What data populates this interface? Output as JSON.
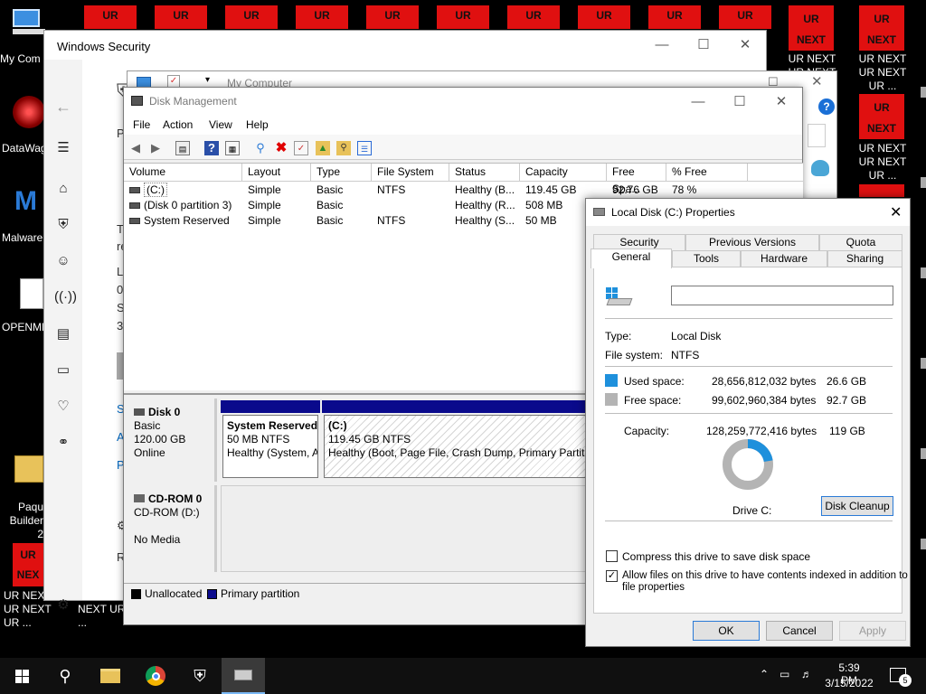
{
  "desktop": {
    "tiles": [
      {
        "text": "UR"
      },
      {
        "text": "UR"
      },
      {
        "text": "UR"
      },
      {
        "text": "UR"
      },
      {
        "text": "UR"
      },
      {
        "text": "UR"
      },
      {
        "text": "UR"
      },
      {
        "text": "UR"
      },
      {
        "text": "UR"
      },
      {
        "text": "UR"
      }
    ],
    "next_tiles": [
      {
        "top": "UR",
        "bottom": "NEXT"
      },
      {
        "top": "UR",
        "bottom": "NEXT"
      },
      {
        "top": "UR",
        "bottom": "NEXT"
      }
    ],
    "icons": [
      {
        "label": "My Com"
      },
      {
        "label": "DataWag"
      },
      {
        "label": "Malware"
      },
      {
        "label": "OPENME"
      },
      {
        "label": "Paqu Builder 2"
      }
    ],
    "right_labels": [
      "UR NEXT UR NEXT UR ...",
      "UR NEXT UR NEXT UR ...",
      "UR NEXT UR NEXT UR ..."
    ],
    "bottom_tile": {
      "top": "UR",
      "bottom": "NEX"
    },
    "bottom_labels": [
      "UR NEXT UR NEXT UR ...",
      "NEXT UR ..."
    ]
  },
  "windows_security": {
    "title": "Windows Security",
    "fragments": [
      "P",
      "T",
      "re",
      "L",
      "0",
      "S",
      "3",
      "S",
      "A",
      "P",
      "R"
    ]
  },
  "my_computer": {
    "title": "My Computer"
  },
  "disk_management": {
    "title": "Disk Management",
    "menu": [
      "File",
      "Action",
      "View",
      "Help"
    ],
    "columns": [
      "Volume",
      "Layout",
      "Type",
      "File System",
      "Status",
      "Capacity",
      "Free Spa...",
      "% Free"
    ],
    "rows": [
      [
        "(C:)",
        "Simple",
        "Basic",
        "NTFS",
        "Healthy (B...",
        "119.45 GB",
        "92.76 GB",
        "78 %"
      ],
      [
        "(Disk 0 partition 3)",
        "Simple",
        "Basic",
        "",
        "Healthy (R...",
        "508 MB",
        "",
        ""
      ],
      [
        "System Reserved",
        "Simple",
        "Basic",
        "NTFS",
        "Healthy (S...",
        "50 MB",
        "",
        ""
      ]
    ],
    "disk0": {
      "name": "Disk 0",
      "type": "Basic",
      "size": "120.00 GB",
      "state": "Online",
      "partitions": [
        {
          "name": "System Reserved",
          "size": "50 MB NTFS",
          "status": "Healthy (System, A"
        },
        {
          "name": "(C:)",
          "size": "119.45 GB NTFS",
          "status": "Healthy (Boot, Page File, Crash Dump, Primary Partitio"
        }
      ]
    },
    "cdrom0": {
      "name": "CD-ROM 0",
      "type": "CD-ROM (D:)",
      "state": "No Media"
    },
    "legend": [
      {
        "label": "Unallocated",
        "color": "#000000"
      },
      {
        "label": "Primary partition",
        "color": "#0a0a8c"
      }
    ]
  },
  "properties": {
    "title": "Local Disk (C:) Properties",
    "tabs_row1": [
      "Security",
      "Previous Versions",
      "Quota"
    ],
    "tabs_row2": [
      "General",
      "Tools",
      "Hardware",
      "Sharing"
    ],
    "name_value": "",
    "type_label": "Type:",
    "type_value": "Local Disk",
    "fs_label": "File system:",
    "fs_value": "NTFS",
    "used_label": "Used space:",
    "used_bytes": "28,656,812,032 bytes",
    "used_gb": "26.6 GB",
    "used_color": "#1e90dc",
    "free_label": "Free space:",
    "free_bytes": "99,602,960,384 bytes",
    "free_gb": "92.7 GB",
    "free_color": "#b4b4b4",
    "capacity_label": "Capacity:",
    "capacity_bytes": "128,259,772,416 bytes",
    "capacity_gb": "119 GB",
    "used_fraction": 0.223,
    "drive_label": "Drive C:",
    "cleanup": "Disk Cleanup",
    "compress": "Compress this drive to save disk space",
    "compress_checked": false,
    "index_line1": "Allow files on this drive to have contents indexed in addition to",
    "index_line2": "file properties",
    "index_checked": true,
    "ok": "OK",
    "cancel": "Cancel",
    "apply": "Apply"
  },
  "taskbar": {
    "time": "5:39 PM",
    "date": "3/15/2022",
    "notification_count": "5"
  }
}
